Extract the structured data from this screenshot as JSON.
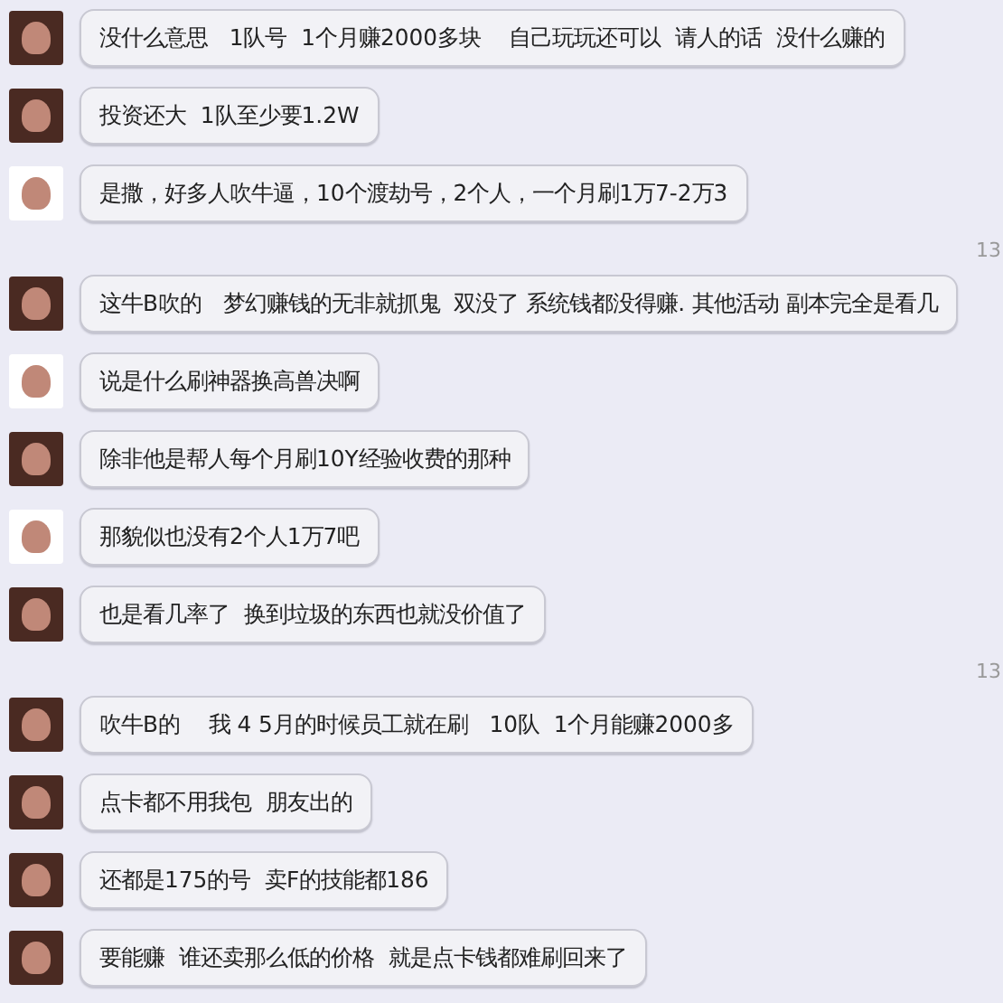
{
  "messages": [
    {
      "kind": "message",
      "color": "#4a2a22",
      "text": "没什么意思   1队号  1个月赚2000多块    自己玩玩还可以  请人的话  没什么赚的"
    },
    {
      "kind": "message",
      "color": "#4a2a22",
      "text": "投资还大  1队至少要1.2W"
    },
    {
      "kind": "message",
      "color": "#ffffff",
      "text": "是撒，好多人吹牛逼，10个渡劫号，2个人，一个月刷1万7-2万3"
    },
    {
      "kind": "timestamp",
      "text": "13"
    },
    {
      "kind": "message",
      "color": "#4a2a22",
      "text": "这牛B吹的   梦幻赚钱的无非就抓鬼  双没了 系统钱都没得赚. 其他活动 副本完全是看几"
    },
    {
      "kind": "message",
      "color": "#ffffff",
      "text": "说是什么刷神器换高兽决啊"
    },
    {
      "kind": "message",
      "color": "#4a2a22",
      "text": "除非他是帮人每个月刷10Y经验收费的那种"
    },
    {
      "kind": "message",
      "color": "#ffffff",
      "text": "那貌似也没有2个人1万7吧"
    },
    {
      "kind": "message",
      "color": "#4a2a22",
      "text": "也是看几率了  换到垃圾的东西也就没价值了"
    },
    {
      "kind": "timestamp",
      "text": "13"
    },
    {
      "kind": "message",
      "color": "#4a2a22",
      "text": "吹牛B的    我 4 5月的时候员工就在刷   10队  1个月能赚2000多"
    },
    {
      "kind": "message",
      "color": "#4a2a22",
      "text": "点卡都不用我包  朋友出的"
    },
    {
      "kind": "message",
      "color": "#4a2a22",
      "text": "还都是175的号  卖F的技能都186"
    },
    {
      "kind": "message",
      "color": "#4a2a22",
      "text": "要能赚  谁还卖那么低的价格  就是点卡钱都难刷回来了"
    }
  ]
}
